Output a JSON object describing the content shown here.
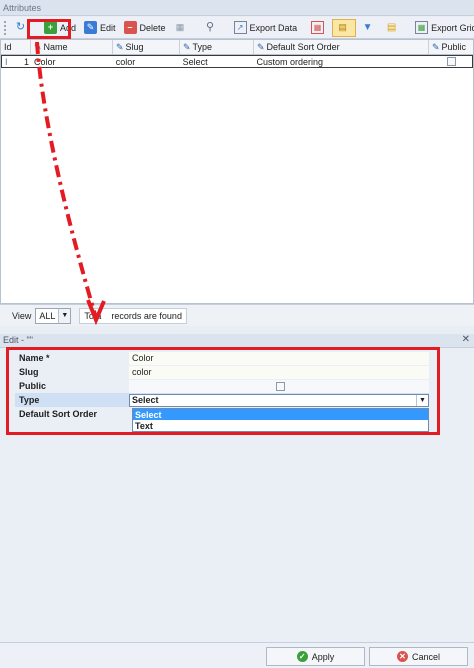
{
  "panel": {
    "title": "Attributes"
  },
  "toolbar": {
    "add_label": "Add",
    "edit_label": "Edit",
    "delete_label": "Delete",
    "export_data_label": "Export Data",
    "export_grid_label": "Export Grid"
  },
  "grid": {
    "columns": [
      "Id",
      "Name",
      "Slug",
      "Type",
      "Default Sort Order",
      "Public"
    ],
    "row": {
      "indicator": "I",
      "id": "1",
      "name": "Color",
      "slug": "color",
      "type": "Select",
      "sort": "Custom ordering"
    }
  },
  "status": {
    "view_label": "View",
    "view_value": "ALL",
    "records_left": "Tota",
    "records_right": "records are found"
  },
  "edit": {
    "title": "Edit - \"\"",
    "fields": {
      "name_label": "Name *",
      "name_value": "Color",
      "slug_label": "Slug",
      "slug_value": "color",
      "public_label": "Public",
      "type_label": "Type",
      "type_value": "Select",
      "sort_label": "Default Sort Order"
    },
    "type_options": [
      "Select",
      "Text"
    ]
  },
  "buttons": {
    "apply": "Apply",
    "cancel": "Cancel"
  },
  "colors": {
    "highlight": "#e31b23",
    "selection": "#3399ff",
    "accent": "#2d5fa7"
  }
}
